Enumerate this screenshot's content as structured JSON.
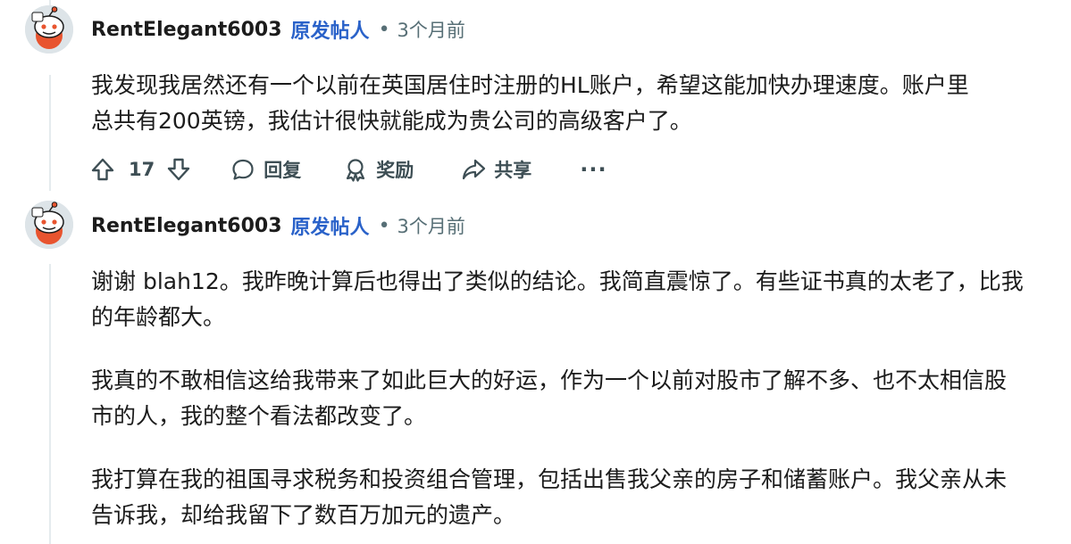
{
  "comments": [
    {
      "author": "RentElegant6003",
      "op_badge": "原发帖人",
      "separator": "•",
      "timestamp": "3个月前",
      "paragraphs": [
        "我发现我居然还有一个以前在英国居住时注册的HL账户，希望这能加快办理速度。账户里",
        "总共有200英镑，我估计很快就能成为贵公司的高级客户了。"
      ],
      "vote_count": "17",
      "actions": {
        "reply": "回复",
        "award": "奖励",
        "share": "共享",
        "more": "···"
      }
    },
    {
      "author": "RentElegant6003",
      "op_badge": "原发帖人",
      "separator": "•",
      "timestamp": "3个月前",
      "paragraphs": [
        "谢谢 blah12。我昨晚计算后也得出了类似的结论。我简直震惊了。有些证书真的太老了，比我的年龄都大。",
        "我真的不敢相信这给我带来了如此巨大的好运，作为一个以前对股市了解不多、也不太相信股市的人，我的整个看法都改变了。",
        "我打算在我的祖国寻求税务和投资组合管理，包括出售我父亲的房子和储蓄账户。我父亲从未告诉我，却给我留下了数百万加元的遗产。"
      ]
    }
  ],
  "colors": {
    "text": "#1c1c1c",
    "op_badge": "#2a62c9",
    "meta": "#576f76",
    "action": "#3d4e54",
    "avatar_accent": "#e8542f"
  }
}
